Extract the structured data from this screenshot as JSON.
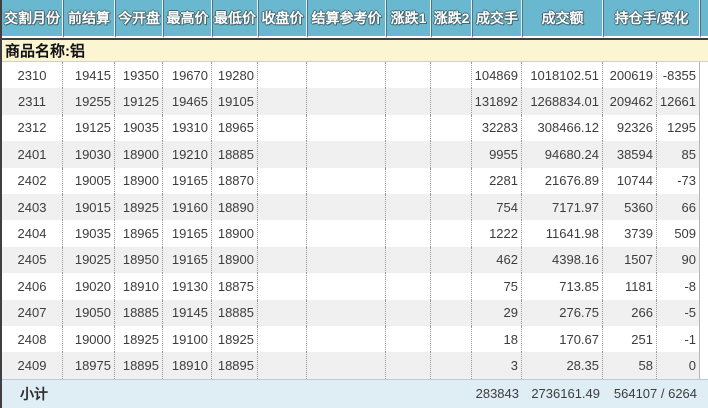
{
  "table": {
    "columns": [
      {
        "label": "交割月份"
      },
      {
        "label": "前结算"
      },
      {
        "label": "今开盘"
      },
      {
        "label": "最高价"
      },
      {
        "label": "最低价"
      },
      {
        "label": "收盘价"
      },
      {
        "label": "结算参考价"
      },
      {
        "label": "涨跌1"
      },
      {
        "label": "涨跌2"
      },
      {
        "label": "成交手"
      },
      {
        "label": "成交额"
      },
      {
        "label": "持仓手/变化"
      }
    ],
    "group_label": "商品名称:铝",
    "rows": [
      [
        "2310",
        "19415",
        "19350",
        "19670",
        "19280",
        "",
        "",
        "",
        "",
        "104869",
        "1018102.51",
        "200619",
        "-8355"
      ],
      [
        "2311",
        "19255",
        "19125",
        "19465",
        "19105",
        "",
        "",
        "",
        "",
        "131892",
        "1268834.01",
        "209462",
        "12661"
      ],
      [
        "2312",
        "19125",
        "19035",
        "19310",
        "18965",
        "",
        "",
        "",
        "",
        "32283",
        "308466.12",
        "92326",
        "1295"
      ],
      [
        "2401",
        "19030",
        "18900",
        "19210",
        "18885",
        "",
        "",
        "",
        "",
        "9955",
        "94680.24",
        "38594",
        "85"
      ],
      [
        "2402",
        "19005",
        "18900",
        "19165",
        "18870",
        "",
        "",
        "",
        "",
        "2281",
        "21676.89",
        "10744",
        "-73"
      ],
      [
        "2403",
        "19015",
        "18925",
        "19160",
        "18890",
        "",
        "",
        "",
        "",
        "754",
        "7171.97",
        "5360",
        "66"
      ],
      [
        "2404",
        "19035",
        "18965",
        "19165",
        "18900",
        "",
        "",
        "",
        "",
        "1222",
        "11641.98",
        "3739",
        "509"
      ],
      [
        "2405",
        "19025",
        "18950",
        "19165",
        "18900",
        "",
        "",
        "",
        "",
        "462",
        "4398.16",
        "1507",
        "90"
      ],
      [
        "2406",
        "19020",
        "18910",
        "19130",
        "18875",
        "",
        "",
        "",
        "",
        "75",
        "713.85",
        "1181",
        "-8"
      ],
      [
        "2407",
        "19050",
        "18885",
        "19145",
        "18885",
        "",
        "",
        "",
        "",
        "29",
        "276.75",
        "266",
        "-5"
      ],
      [
        "2408",
        "19000",
        "18925",
        "19100",
        "18925",
        "",
        "",
        "",
        "",
        "18",
        "170.67",
        "251",
        "-1"
      ],
      [
        "2409",
        "18975",
        "18895",
        "18910",
        "18895",
        "",
        "",
        "",
        "",
        "3",
        "28.35",
        "58",
        "0"
      ]
    ],
    "subtotal": {
      "label": "小计",
      "volume": "283843",
      "turnover": "2736161.49",
      "open_interest": "564107 / 6264"
    }
  },
  "colors": {
    "header_bg": "#69b8d0",
    "header_text": "#ffffff",
    "header_text_outline": "#47666f",
    "group_bg": "#fbf5d1",
    "row_bg": "#ffffff",
    "stripe_bg": "#f0f0f0",
    "subtotal_bg": "#dfedf5",
    "text": "#3d3d3d",
    "frame_border": "#3f3f3f",
    "dotted_line": "#999999"
  }
}
